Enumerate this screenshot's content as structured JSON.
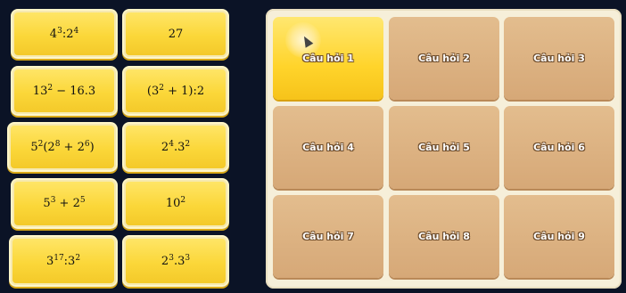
{
  "answer_cards": [
    {
      "html": "4<sup>3</sup>:2<sup>4</sup>",
      "text": "4³:2⁴"
    },
    {
      "html": "27",
      "text": "27"
    },
    {
      "html": "13<sup>2</sup> − 16.3",
      "text": "13² − 16.3"
    },
    {
      "html": "(3<sup>2</sup> + 1):2",
      "text": "(3² + 1):2"
    },
    {
      "html": "5<sup>2</sup>(2<sup>8</sup> + 2<sup>6</sup>)",
      "text": "5²(2⁸ + 2⁶)"
    },
    {
      "html": "2<sup>4</sup>.3<sup>2</sup>",
      "text": "2⁴.3²"
    },
    {
      "html": "5<sup>3</sup> + 2<sup>5</sup>",
      "text": "5³ + 2⁵"
    },
    {
      "html": "10<sup>2</sup>",
      "text": "10²"
    },
    {
      "html": "3<sup>17</sup>:3<sup>2</sup>",
      "text": "3¹⁷:3²"
    },
    {
      "html": "2<sup>3</sup>.3<sup>3</sup>",
      "text": "2³.3³"
    }
  ],
  "question_tiles": [
    {
      "label": "Câu hỏi 1",
      "state": "active"
    },
    {
      "label": "Câu hỏi 2",
      "state": "idle"
    },
    {
      "label": "Câu hỏi 3",
      "state": "idle"
    },
    {
      "label": "Câu hỏi 4",
      "state": "idle"
    },
    {
      "label": "Câu hỏi 5",
      "state": "idle"
    },
    {
      "label": "Câu hỏi 6",
      "state": "idle"
    },
    {
      "label": "Câu hỏi 7",
      "state": "idle"
    },
    {
      "label": "Câu hỏi 8",
      "state": "idle"
    },
    {
      "label": "Câu hỏi 9",
      "state": "idle"
    }
  ],
  "colors": {
    "background": "#0b1326",
    "card_yellow": "#fbd739",
    "tile_tan": "#d6a877",
    "tile_active": "#ffd42b",
    "board": "#f6efd9"
  }
}
